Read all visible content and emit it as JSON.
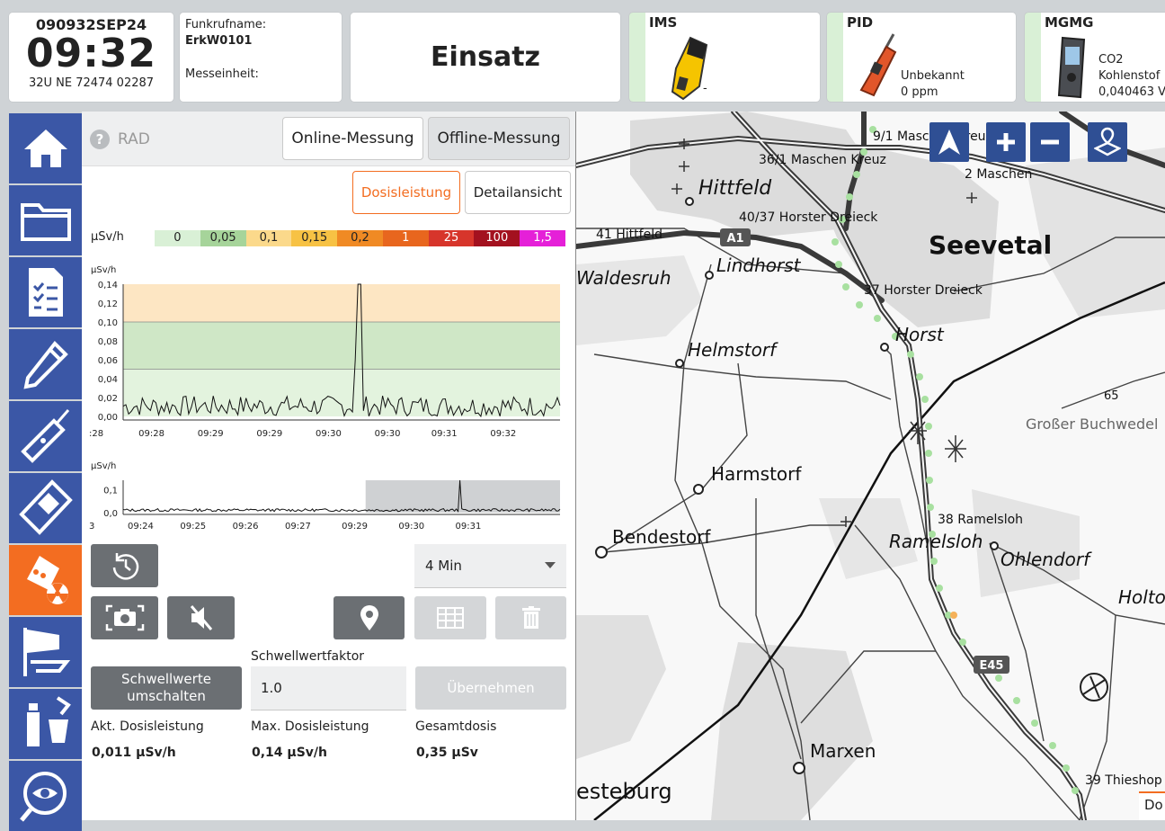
{
  "header": {
    "dtg": "090932SEP24",
    "time": "09:32",
    "coords": "32U NE 72474 02287",
    "funkrufname_label": "Funkrufname:",
    "funkrufname_value": "ErkW0101",
    "messeinheit_label": "Messeinheit:",
    "mode": "Einsatz"
  },
  "devices": [
    {
      "name": "IMS",
      "line1": "",
      "line2": "-"
    },
    {
      "name": "PID",
      "line1": "Unbekannt",
      "line2": "0 ppm"
    },
    {
      "name": "MGMG",
      "line1": "CO2",
      "line2": "Kohlenstof",
      "line3": "0,040463 V"
    }
  ],
  "sidebar": {
    "items": [
      {
        "icon": "home-icon"
      },
      {
        "icon": "folder-icon"
      },
      {
        "icon": "checklist-icon"
      },
      {
        "icon": "probe-icon"
      },
      {
        "icon": "pid-device-icon"
      },
      {
        "icon": "handheld-device-icon"
      },
      {
        "icon": "radiation-device-icon",
        "active": true
      },
      {
        "icon": "wind-icon"
      },
      {
        "icon": "sampling-icon"
      },
      {
        "icon": "eye-icon"
      }
    ]
  },
  "panel": {
    "help_label": "RAD",
    "online_label": "Online-Messung",
    "offline_label": "Offline-Messung",
    "tab_dose": "Dosisleistung",
    "tab_detail": "Detailansicht",
    "scale_unit": "µSv/h",
    "scale_labels": [
      "0",
      "0,05",
      "0,1",
      "0,15",
      "0,2",
      "1",
      "25",
      "100",
      "1,5"
    ],
    "scale_colors": [
      "#d9f0d6",
      "#a6d49a",
      "#fbd98b",
      "#f7c244",
      "#f08a24",
      "#e8661e",
      "#d7352b",
      "#a3111f",
      "#e520d8"
    ],
    "timespan": "4 Min",
    "threshold_toggle": "Schwellwerte umschalten",
    "threshold_factor_label": "Schwellwertfaktor",
    "threshold_factor_value": "1.0",
    "apply_label": "Übernehmen",
    "current_label": "Akt. Dosisleistung",
    "current_value": "0,011 µSv/h",
    "max_label": "Max. Dosisleistung",
    "max_value": "0,14 µSv/h",
    "total_label": "Gesamtdosis",
    "total_value": "0,35 µSv"
  },
  "chart_data": [
    {
      "type": "line",
      "ylabel": "µSv/h",
      "ylim": [
        0,
        0.14
      ],
      "yticks": [
        "0,00",
        "0,02",
        "0,04",
        "0,06",
        "0,08",
        "0,10",
        "0,12",
        "0,14"
      ],
      "xticks": [
        ":28",
        "09:28",
        "09:29",
        "09:29",
        "09:30",
        "09:30",
        "09:31",
        "09:32"
      ],
      "bands": [
        {
          "from": 0,
          "to": 0.05,
          "color": "#e3f3de"
        },
        {
          "from": 0.05,
          "to": 0.1,
          "color": "#cfe7c6"
        },
        {
          "from": 0.1,
          "to": 0.14,
          "color": "#fde6c3"
        }
      ],
      "peak": {
        "position": 0.54,
        "value": 0.14
      },
      "baseline": 0.011
    },
    {
      "type": "line",
      "ylabel": "µSv/h",
      "ylim": [
        0,
        0.14
      ],
      "yticks": [
        "0,0",
        "0,1"
      ],
      "xticks": [
        "3",
        "09:24",
        "09:25",
        "09:26",
        "09:27",
        "09:29",
        "09:30",
        "09:31"
      ],
      "peak": {
        "position": 0.77,
        "value": 0.14
      },
      "baseline": 0.011,
      "window": [
        0.555,
        1.0
      ]
    }
  ],
  "map": {
    "labels": {
      "seevetal": "Seevetal",
      "hittfeld": "Hittfeld",
      "lindhorst": "Lindhorst",
      "waldesruh": "Waldesruh",
      "helmstorf": "Helmstorf",
      "harmstorf": "Harmstorf",
      "bendestorf": "Bendestorf",
      "marxen": "Marxen",
      "ramelsloh": "Ramelsloh",
      "ohlendorf": "Ohlendorf",
      "horst": "Horst",
      "holto": "Holto",
      "buchwedel": "Großer Buchwedel",
      "esteburg": "esteburg",
      "a1": "A1",
      "e45": "E45",
      "exit_hittfeld": "41 Hittfeld",
      "exit_horster": "40/37 Horster Dreieck",
      "exit_maschen_kreuz": "36/1 Maschen Kreuz",
      "exit_maschen": "2 Maschen",
      "exit_maschen_kreuz2": "9/1 Maschen Kreuz",
      "exit_horster2": "37 Horster Dreieck",
      "exit_ramelsloh": "38 Ramelsloh",
      "exit_thieshop": "39 Thieshop",
      "spot_height": "65",
      "corner": "Do"
    }
  }
}
